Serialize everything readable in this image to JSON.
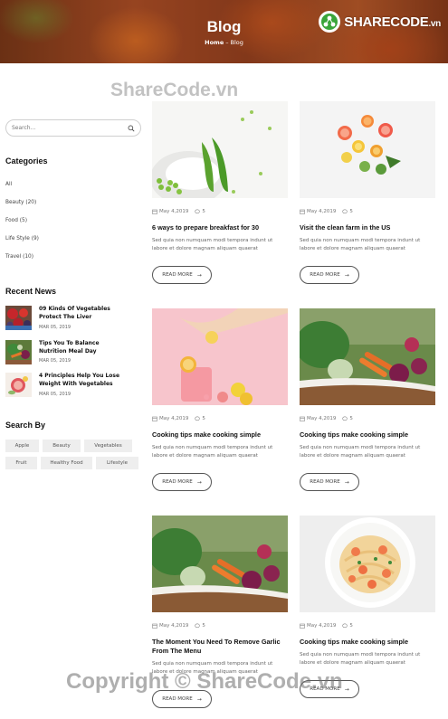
{
  "hero": {
    "title": "Blog",
    "breadcrumb_home": "Home",
    "breadcrumb_sep": "–",
    "breadcrumb_current": "Blog"
  },
  "brand": {
    "name": "SHARECODE",
    "domain": ".vn"
  },
  "watermarks": {
    "top": "ShareCode.vn",
    "bottom": "Copyright © ShareCode.vn"
  },
  "sidebar": {
    "search_placeholder": "Search...",
    "categories_heading": "Categories",
    "categories": [
      "All",
      "Beauty (20)",
      "Food (5)",
      "Life Style (9)",
      "Travel (10)"
    ],
    "recent_heading": "Recent News",
    "recent": [
      {
        "title": "09 Kinds Of Vegetables Protect The Liver",
        "date": "MAR 05, 2019",
        "thumb": "tomatoes-berries-thumb"
      },
      {
        "title": "Tips You To Balance Nutrition Meal Day",
        "date": "MAR 05, 2019",
        "thumb": "vegetables-thumb"
      },
      {
        "title": "4 Principles Help You Lose Weight With Vegetables",
        "date": "MAR 05, 2019",
        "thumb": "pomegranate-thumb"
      }
    ],
    "search_by_heading": "Search By",
    "tags": [
      "Apple",
      "Beauty",
      "Vegetables",
      "Fruit",
      "Healthy Food",
      "Lifestyle"
    ]
  },
  "posts": [
    {
      "date": "May 4,2019",
      "comments": "5",
      "title": "6 ways to prepare breakfast for 30",
      "excerpt": "Sed quia non numquam modi tempora indunt ut labore et dolore magnam aliquam quaerat",
      "read_more": "READ MORE",
      "image": "peas"
    },
    {
      "date": "May 4,2019",
      "comments": "5",
      "title": "Visit the clean farm in the US",
      "excerpt": "Sed quia non numquam modi tempora indunt ut labore et dolore magnam aliquam quaerat",
      "read_more": "READ MORE",
      "image": "citrus"
    },
    {
      "date": "May 4,2019",
      "comments": "5",
      "title": "Cooking tips make cooking simple",
      "excerpt": "Sed quia non numquam modi tempora indunt ut labore et dolore magnam aliquam quaerat",
      "read_more": "READ MORE",
      "image": "lemonade"
    },
    {
      "date": "May 4,2019",
      "comments": "5",
      "title": "Cooking tips make cooking simple",
      "excerpt": "Sed quia non numquam modi tempora indunt ut labore et dolore magnam aliquam quaerat",
      "read_more": "READ MORE",
      "image": "vegetable-basket"
    },
    {
      "date": "May 4,2019",
      "comments": "5",
      "title": "The Moment You Need To Remove Garlic From The Menu",
      "excerpt": "Sed quia non numquam modi tempora indunt ut labore et dolore magnam aliquam quaerat",
      "read_more": "READ MORE",
      "image": "vegetable-basket"
    },
    {
      "date": "May 4,2019",
      "comments": "5",
      "title": "Cooking tips make cooking simple",
      "excerpt": "Sed quia non numquam modi tempora indunt ut labore et dolore magnam aliquam quaerat",
      "read_more": "READ MORE",
      "image": "shrimp-pasta"
    }
  ]
}
